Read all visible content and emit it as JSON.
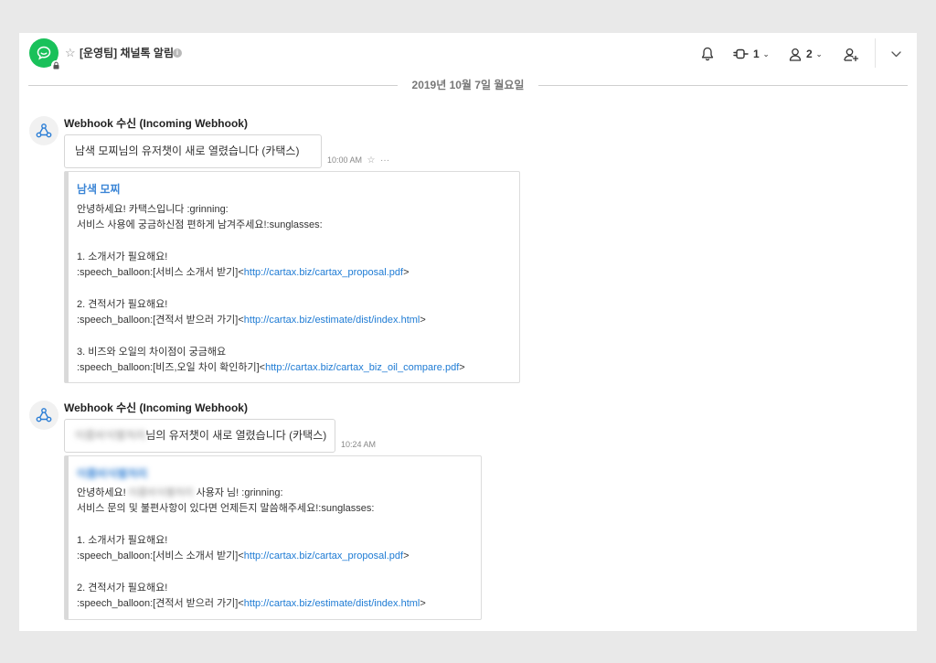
{
  "header": {
    "channel_title": "[운영팀] 채널톡 알림",
    "count_integrations": "1",
    "count_members": "2"
  },
  "date_divider": "2019년 10월 7일 월요일",
  "messages": [
    {
      "sender": "Webhook 수신 (Incoming Webhook)",
      "text": "남색 모찌님의 유저챗이 새로 열렸습니다 (카택스)",
      "time": "10:00 AM",
      "attachment": {
        "title": "남색 모찌",
        "greeting": "안녕하세요! 카택스입니다 :grinning:",
        "line2": "서비스 사용에 궁금하신점 편하게 남겨주세요!:sunglasses:",
        "item1": "1. 소개서가 필요해요!",
        "item1_prefix": ":speech_balloon:[서비스 소개서 받기]<",
        "item1_url": "http://cartax.biz/cartax_proposal.pdf",
        "item1_suffix": ">",
        "item2": "2. 견적서가 필요해요!",
        "item2_prefix": ":speech_balloon:[견적서 받으러 가기]<",
        "item2_url": "http://cartax.biz/estimate/dist/index.html",
        "item2_suffix": ">",
        "item3": "3. 비즈와 오일의 차이점이 궁금해요",
        "item3_prefix": ":speech_balloon:[비즈,오일 차이 확인하기]<",
        "item3_url": "http://cartax.biz/cartax_biz_oil_compare.pdf",
        "item3_suffix": ">"
      }
    },
    {
      "sender": "Webhook 수신 (Incoming Webhook)",
      "text_blurred": "이름비식별처리",
      "text": "님의 유저챗이 새로 열렸습니다 (카택스)",
      "time": "10:24 AM",
      "attachment": {
        "title_blurred": "이름비식별처리",
        "greeting_prefix": "안녕하세요! ",
        "greeting_blurred": "이름비식별처리",
        "greeting_suffix": " 사용자 님! :grinning:",
        "line2": "서비스 문의 및 불편사항이 있다면 언제든지 말씀해주세요!:sunglasses:",
        "item1": "1. 소개서가 필요해요!",
        "item1_prefix": ":speech_balloon:[서비스 소개서 받기]<",
        "item1_url": "http://cartax.biz/cartax_proposal.pdf",
        "item1_suffix": ">",
        "item2": "2. 견적서가 필요해요!",
        "item2_prefix": ":speech_balloon:[견적서 받으러 가기]<",
        "item2_url": "http://cartax.biz/estimate/dist/index.html",
        "item2_suffix": ">"
      }
    }
  ],
  "icons": {
    "channel_avatar": "chat-bubble-icon",
    "lock": "lock-icon",
    "favorite": "star-icon",
    "info": "info-icon",
    "notifications": "bell-icon",
    "integrations": "plug-icon",
    "members": "user-icon",
    "invite": "add-user-icon",
    "more": "chevron-down-icon",
    "bot_avatar": "webhook-icon"
  },
  "colors": {
    "channel_green": "#19c15a",
    "link_blue": "#1e7bd4",
    "attachment_title_blue": "#3c86d6"
  }
}
